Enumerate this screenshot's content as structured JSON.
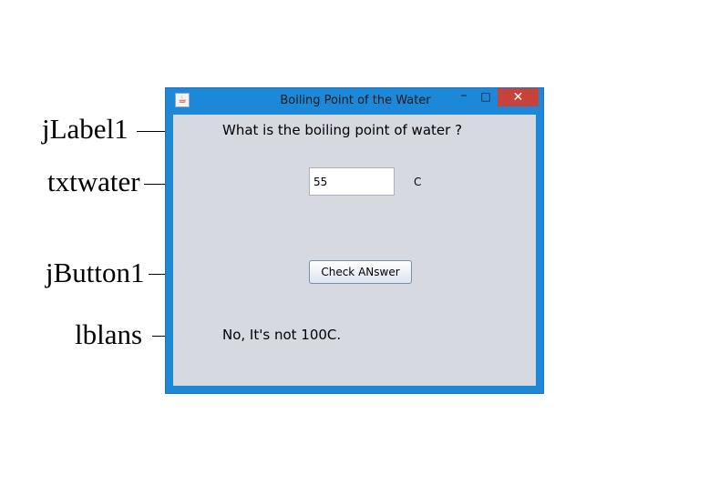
{
  "annotations": {
    "label1": "jLabel1",
    "txtwater": "txtwater",
    "button1": "jButton1",
    "lblans": "lblans"
  },
  "window": {
    "title": "Boiling Point of the Water",
    "app_icon": "java-app-icon",
    "minimize_glyph": "–",
    "maximize_glyph": "□",
    "close_glyph": "✕"
  },
  "form": {
    "question": "What is the boiling point of water ?",
    "water_value": "55",
    "unit": "C",
    "check_button_label": "Check ANswer",
    "answer": "No, It's not 100C."
  },
  "colors": {
    "title_bar": "#1e88d8",
    "close_button": "#c7423a",
    "content_bg": "#d6d9e0"
  }
}
